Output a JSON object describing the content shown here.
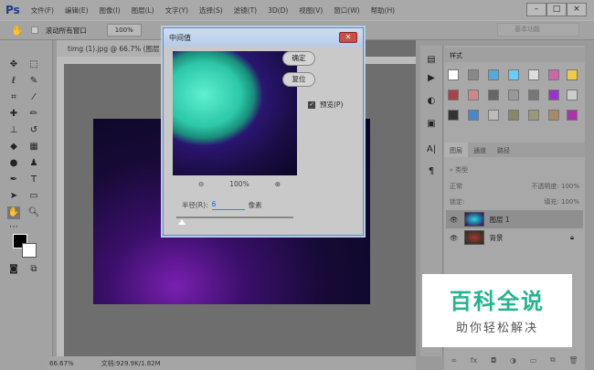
{
  "app": {
    "logo": "Ps",
    "menus": [
      "文件(F)",
      "编辑(E)",
      "图像(I)",
      "图层(L)",
      "文字(Y)",
      "选择(S)",
      "滤镜(T)",
      "3D(D)",
      "视图(V)",
      "窗口(W)",
      "帮助(H)"
    ],
    "window_buttons": [
      "–",
      "□",
      "×"
    ]
  },
  "options": {
    "scroll_all_label": "滚动所有窗口",
    "zoom_value": "100%",
    "workspace": "基本功能"
  },
  "document": {
    "tab_title": "timg (1).jpg @ 66.7% (图层 1, RGB",
    "zoom": "66.67%",
    "doc_info": "文档:929.9K/1.82M"
  },
  "dialog": {
    "title": "中间值",
    "ok": "确定",
    "reset": "复位",
    "preview_label": "预览(P)",
    "preview_checked": true,
    "preview_zoom": "100%",
    "radius_label": "半径(R):",
    "radius_value": "6",
    "radius_unit": "像素"
  },
  "styles_panel": {
    "tab": "样式"
  },
  "layers_panel": {
    "tabs": [
      "图层",
      "通道",
      "路径"
    ],
    "filter": "类型",
    "blend_mode": "正常",
    "opacity_label": "不透明度:",
    "opacity": "100%",
    "lock_label": "锁定:",
    "fill_label": "填充:",
    "fill": "100%",
    "layers": [
      {
        "name": "图层 1",
        "selected": true
      },
      {
        "name": "背景",
        "locked": true
      }
    ]
  },
  "watermark": {
    "title": "百科全说",
    "subtitle": "助你轻松解决"
  },
  "colors": {
    "accent_green": "#25b48d"
  }
}
